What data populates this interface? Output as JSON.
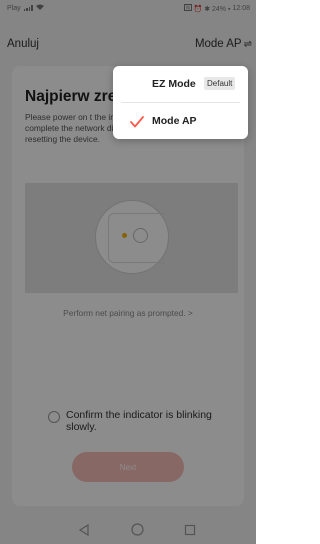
{
  "status_bar": {
    "left_text": "Play",
    "right_text": "⏰ ✱ 24% ▪ ",
    "time": "12:08"
  },
  "header": {
    "cancel_label": "Anuluj",
    "mode_label": "Mode AP",
    "mode_icon": "swap-arrows-icon"
  },
  "card": {
    "title": "Najpierw zre",
    "instructions": "Please power on t the indicator is bli Note: please complete the network distribution within 3 minutes after resetting the device."
  },
  "pairing_link": "Perform net pairing as prompted. >",
  "confirm": {
    "label": "Confirm the indicator is blinking slowly.",
    "checked": false
  },
  "next_button": {
    "label": "Next",
    "enabled": false
  },
  "mode_menu": {
    "items": [
      {
        "label": "EZ Mode",
        "badge": "Default",
        "selected": false
      },
      {
        "label": "Mode AP",
        "badge": "",
        "selected": true
      }
    ]
  },
  "colors": {
    "accent": "#ff5a4a",
    "led": "#f0b400",
    "next_button_disabled": "#f7bdb7"
  }
}
